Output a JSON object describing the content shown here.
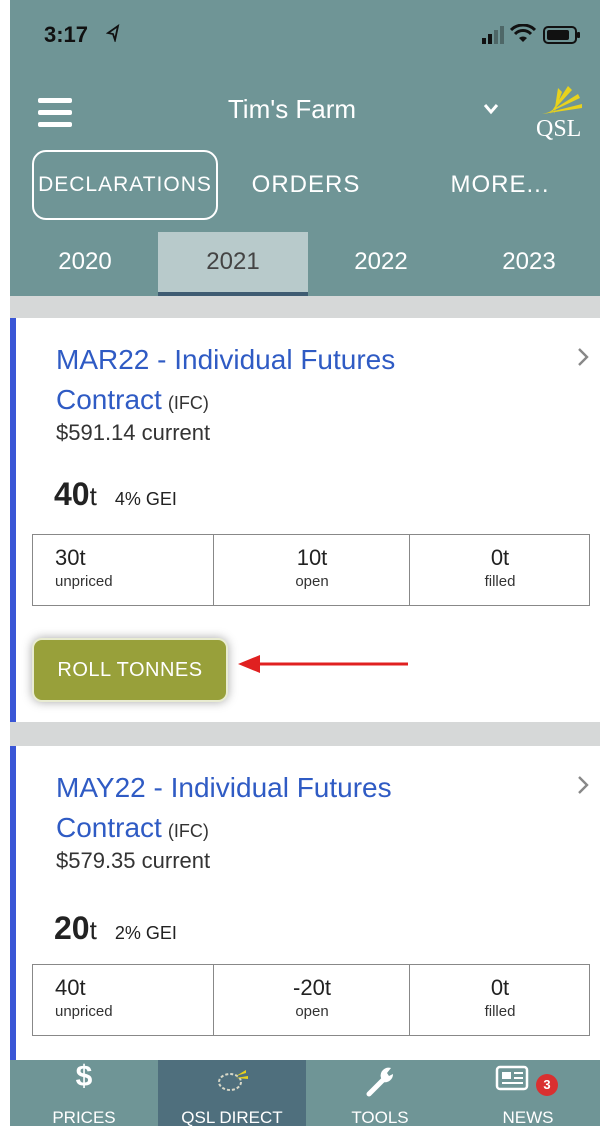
{
  "status_bar": {
    "time": "3:17"
  },
  "header": {
    "farm_name": "Tim's Farm",
    "logo_text": "QSL"
  },
  "tabs": [
    {
      "label": "DECLARATIONS",
      "selected": true
    },
    {
      "label": "ORDERS",
      "selected": false
    },
    {
      "label": "MORE...",
      "selected": false
    }
  ],
  "years": [
    {
      "label": "2020",
      "selected": false
    },
    {
      "label": "2021",
      "selected": true
    },
    {
      "label": "2022",
      "selected": false
    },
    {
      "label": "2023",
      "selected": false
    }
  ],
  "contracts": [
    {
      "title": "MAR22 - Individual Futures Contract",
      "type_abbr": "(IFC)",
      "price_text": "$591.14 current",
      "tonnes": "40",
      "tonnes_unit": "t",
      "gei": "4% GEI",
      "stats": [
        {
          "value": "30t",
          "label": "unpriced"
        },
        {
          "value": "10t",
          "label": "open"
        },
        {
          "value": "0t",
          "label": "filled"
        }
      ],
      "action_label": "ROLL TONNES"
    },
    {
      "title": "MAY22 - Individual Futures Contract",
      "type_abbr": "(IFC)",
      "price_text": "$579.35 current",
      "tonnes": "20",
      "tonnes_unit": "t",
      "gei": "2% GEI",
      "stats": [
        {
          "value": "40t",
          "label": "unpriced"
        },
        {
          "value": "-20t",
          "label": "open"
        },
        {
          "value": "0t",
          "label": "filled"
        }
      ]
    }
  ],
  "bottom_nav": [
    {
      "label": "PRICES",
      "icon": "dollar-icon",
      "selected": false
    },
    {
      "label": "QSL DIRECT",
      "icon": "qsl-direct-icon",
      "selected": true
    },
    {
      "label": "TOOLS",
      "icon": "wrench-icon",
      "selected": false
    },
    {
      "label": "NEWS",
      "icon": "news-icon",
      "selected": false,
      "badge": "3"
    }
  ],
  "colors": {
    "header_bg": "#6f9596",
    "title_blue": "#2f5bc4",
    "card_accent": "#3a56d6",
    "roll_button": "#98a03a",
    "badge_red": "#d93030"
  }
}
